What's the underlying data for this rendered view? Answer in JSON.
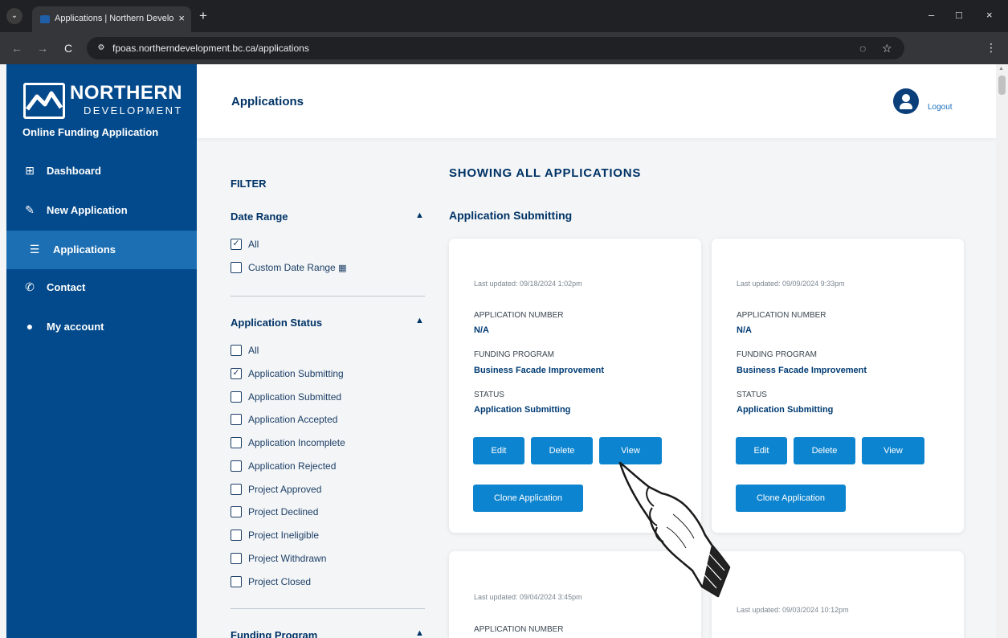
{
  "browser": {
    "tab_title": "Applications | Northern Develo",
    "tab_close": "×",
    "new_tab": "+",
    "url": "fpoas.northerndevelopment.bc.ca/applications",
    "window_controls": [
      "–",
      "□",
      "×"
    ],
    "nav": [
      "←",
      "→",
      "C"
    ],
    "icons": [
      "tab-search-icon",
      "site-info-icon",
      "eye-off-icon",
      "star-icon",
      "menu-dots-icon"
    ]
  },
  "sidebar": {
    "logo_name": "NORTHERN",
    "logo_sub": "DEVELOPMENT",
    "subtitle": "Online Funding Application",
    "items": [
      {
        "label": "Dashboard",
        "icon": "grid-icon"
      },
      {
        "label": "New Application",
        "icon": "pencil-icon"
      },
      {
        "label": "Applications",
        "icon": "list-icon",
        "active": true
      },
      {
        "label": "Contact",
        "icon": "phone-icon"
      },
      {
        "label": "My account",
        "icon": "user-icon"
      }
    ]
  },
  "header": {
    "title": "Applications",
    "logout": "Logout"
  },
  "filter": {
    "title": "FILTER",
    "date_range": {
      "title": "Date Range",
      "options": [
        {
          "label": "All",
          "checked": true
        },
        {
          "label": "Custom Date Range",
          "checked": false
        }
      ]
    },
    "status": {
      "title": "Application Status",
      "options": [
        {
          "label": "All",
          "checked": false
        },
        {
          "label": "Application Submitting",
          "checked": true
        },
        {
          "label": "Application Submitted",
          "checked": false
        },
        {
          "label": "Application Accepted",
          "checked": false
        },
        {
          "label": "Application Incomplete",
          "checked": false
        },
        {
          "label": "Application Rejected",
          "checked": false
        },
        {
          "label": "Project Approved",
          "checked": false
        },
        {
          "label": "Project Declined",
          "checked": false
        },
        {
          "label": "Project Ineligible",
          "checked": false
        },
        {
          "label": "Project Withdrawn",
          "checked": false
        },
        {
          "label": "Project Closed",
          "checked": false
        }
      ]
    },
    "funding_program": {
      "title": "Funding Program"
    }
  },
  "main": {
    "heading": "SHOWING ALL APPLICATIONS",
    "group_title": "Application Submitting",
    "labels": {
      "app_number": "APPLICATION NUMBER",
      "funding_program": "FUNDING PROGRAM",
      "status": "STATUS"
    },
    "buttons": {
      "edit": "Edit",
      "delete": "Delete",
      "view": "View",
      "clone": "Clone Application"
    },
    "cards": [
      {
        "updated": "Last updated: 09/18/2024 1:02pm",
        "app_number": "N/A",
        "funding_program": "Business Facade Improvement",
        "status": "Application Submitting"
      },
      {
        "updated": "Last updated: 09/09/2024 9:33pm",
        "app_number": "N/A",
        "funding_program": "Business Facade Improvement",
        "status": "Application Submitting"
      },
      {
        "updated": "Last updated: 09/04/2024 3:45pm"
      },
      {
        "updated": "Last updated: 09/03/2024 10:12pm"
      }
    ]
  }
}
